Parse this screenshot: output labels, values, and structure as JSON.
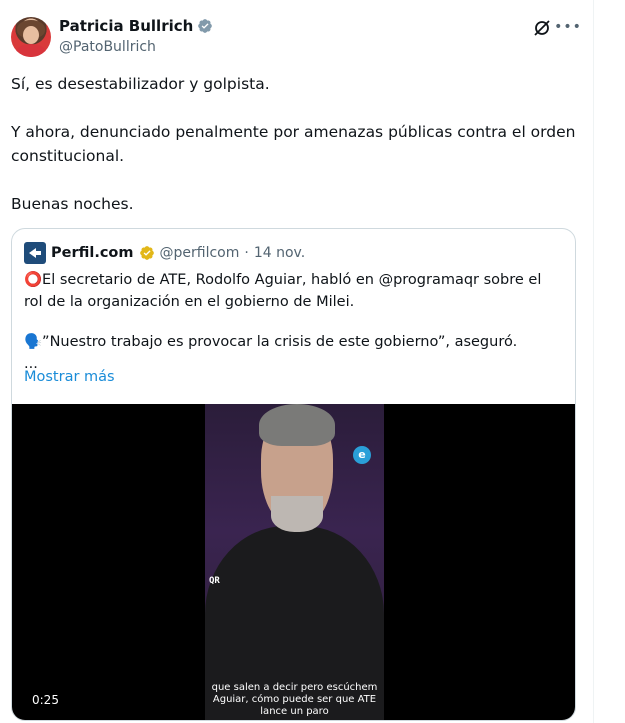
{
  "author": {
    "display_name": "Patricia Bullrich",
    "handle": "@PatoBullrich"
  },
  "icons": {
    "verified": "verified-badge-icon",
    "grok": "grok-icon",
    "more": "more-icon"
  },
  "tweet": {
    "paragraphs": [
      "Sí, es desestabilizador y golpista.",
      "Y ahora, denunciado penalmente por amenazas públicas contra el orden constitucional.",
      "Buenas noches."
    ]
  },
  "quote": {
    "name": "Perfil.com",
    "handle": "@perfilcom",
    "separator": "·",
    "date": "14 nov.",
    "lines": [
      "⭕El secretario de ATE, Rodolfo Aguiar, habló en @programaqr sobre el rol de la organización en el gobierno de Milei.",
      "🗣️”Nuestro trabajo es provocar la crisis de este gobierno”, aseguró.",
      "..."
    ],
    "show_more": "Mostrar más",
    "video": {
      "time": "0:25",
      "subtitle_lines": [
        "que salen a decir pero escúchem",
        "Aguiar, cómo puede ser que ATE",
        "lance un paro"
      ],
      "logo_letter": "e",
      "qr_mark": "QR"
    }
  },
  "colors": {
    "verified_blue": "#1d9bf0",
    "gold_badge": "#e2b719",
    "link": "#1a8cd8",
    "muted": "#536471"
  }
}
